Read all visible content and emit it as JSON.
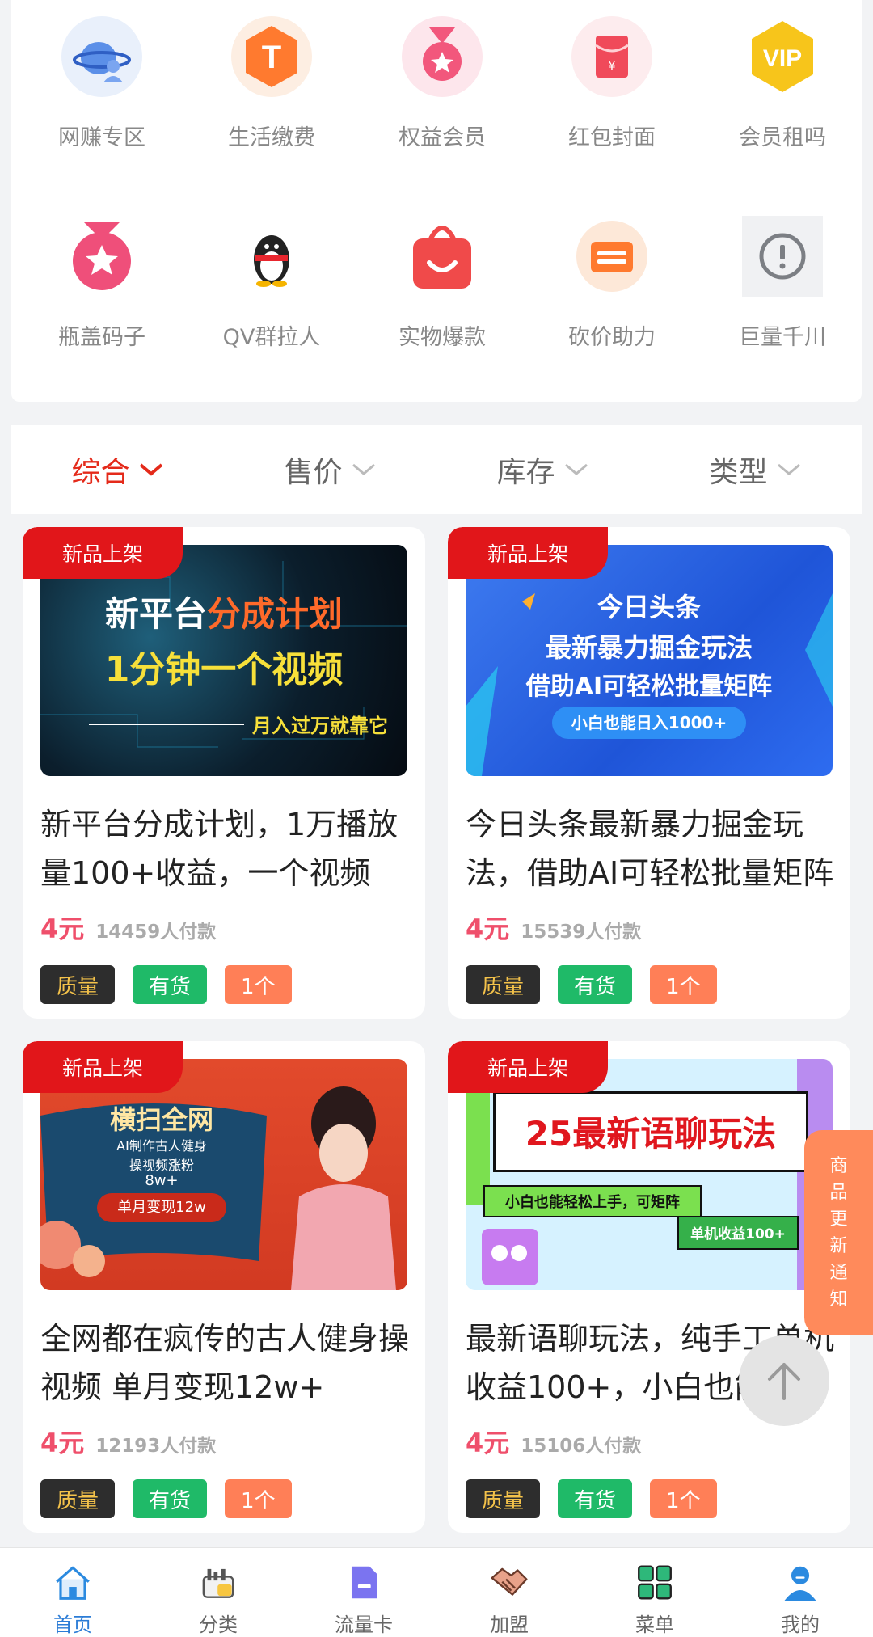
{
  "grid": {
    "items": [
      {
        "label": "网赚专区",
        "icon": "globe-user-icon"
      },
      {
        "label": "生活缴费",
        "icon": "t-coin-icon"
      },
      {
        "label": "权益会员",
        "icon": "medal-icon"
      },
      {
        "label": "红包封面",
        "icon": "red-envelope-icon"
      },
      {
        "label": "会员租吗",
        "icon": "vip-badge-icon"
      },
      {
        "label": "瓶盖码子",
        "icon": "star-medal-icon"
      },
      {
        "label": "QV群拉人",
        "icon": "penguin-icon"
      },
      {
        "label": "实物爆款",
        "icon": "shopping-bag-icon"
      },
      {
        "label": "砍价助力",
        "icon": "coupon-icon"
      },
      {
        "label": "巨量千川",
        "icon": "alert-icon"
      }
    ]
  },
  "sort": {
    "items": [
      {
        "label": "综合",
        "active": true
      },
      {
        "label": "售价",
        "active": false
      },
      {
        "label": "库存",
        "active": false
      },
      {
        "label": "类型",
        "active": false
      }
    ]
  },
  "products": [
    {
      "badge": "新品上架",
      "title": "新平台分成计划，1万播放量100+收益，一个视频",
      "price": "4元",
      "sold": "14459人付款",
      "tags": [
        "质量",
        "有货",
        "1个"
      ],
      "image_text": [
        "新平台",
        "分成计划",
        "1分钟一个视频",
        "月入过万就靠它"
      ]
    },
    {
      "badge": "新品上架",
      "title": "今日头条最新暴力掘金玩法，借助AI可轻松批量矩阵",
      "price": "4元",
      "sold": "15539人付款",
      "tags": [
        "质量",
        "有货",
        "1个"
      ],
      "image_text": [
        "今日头条",
        "最新暴力掘金玩法",
        "借助AI可轻松批量矩阵",
        "小白也能日入1000+"
      ]
    },
    {
      "badge": "新品上架",
      "title": "全网都在疯传的古人健身操视频 单月变现12w+",
      "price": "4元",
      "sold": "12193人付款",
      "tags": [
        "质量",
        "有货",
        "1个"
      ],
      "image_text": [
        "横扫全网",
        "AI制作古人健身",
        "操视频涨粉",
        "8w+",
        "单月变现12w"
      ]
    },
    {
      "badge": "新品上架",
      "title": "最新语聊玩法，纯手工单机收益100+，小白也能",
      "price": "4元",
      "sold": "15106人付款",
      "tags": [
        "质量",
        "有货",
        "1个"
      ],
      "image_text": [
        "25最新语聊玩法",
        "小白也能轻松上手，可矩阵",
        "单机收益100+"
      ]
    }
  ],
  "floating": {
    "notice_chars": [
      "商",
      "品",
      "更",
      "新",
      "通",
      "知"
    ],
    "top_icon": "arrow-up-icon"
  },
  "tabbar": {
    "items": [
      {
        "label": "首页",
        "icon": "home-icon",
        "active": true
      },
      {
        "label": "分类",
        "icon": "category-icon",
        "active": false
      },
      {
        "label": "流量卡",
        "icon": "sim-card-icon",
        "active": false
      },
      {
        "label": "加盟",
        "icon": "handshake-icon",
        "active": false
      },
      {
        "label": "菜单",
        "icon": "grid-menu-icon",
        "active": false
      },
      {
        "label": "我的",
        "icon": "user-icon",
        "active": false
      }
    ]
  },
  "colors": {
    "accent": "#e42a1a",
    "price": "#ef4f6b",
    "tab_active": "#2b7cd6",
    "notice": "#ff8a5b"
  }
}
